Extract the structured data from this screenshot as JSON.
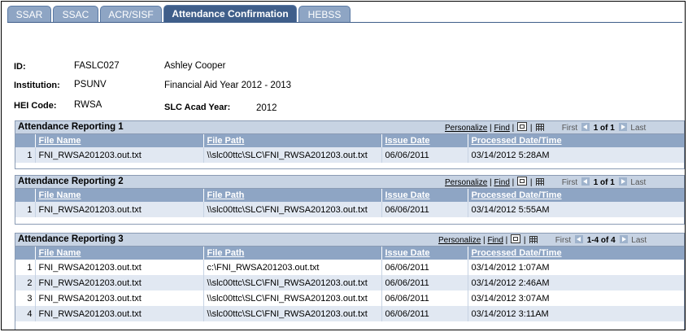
{
  "tabs": [
    {
      "label": "SSAR",
      "active": false
    },
    {
      "label": "SSAC",
      "active": false
    },
    {
      "label": "ACR/SISF",
      "active": false
    },
    {
      "label": "Attendance Confirmation",
      "active": true
    },
    {
      "label": "HEBSS",
      "active": false
    }
  ],
  "info": {
    "id_label": "ID:",
    "id_value": "FASLC027",
    "name": "Ashley Cooper",
    "institution_label": "Institution:",
    "institution_value": "PSUNV",
    "aid_year": "Financial Aid Year 2012 - 2013",
    "hei_label": "HEI Code:",
    "hei_value": "RWSA",
    "slc_label": "SLC Acad Year:",
    "slc_value": "2012"
  },
  "grid_nav": {
    "personalize": "Personalize",
    "separator": "|",
    "find": "Find",
    "first": "First",
    "last": "Last"
  },
  "columns": [
    "File Name",
    "File Path",
    "Issue Date",
    "Processed Date/Time"
  ],
  "grids": [
    {
      "title": "Attendance Reporting 1",
      "count": "1 of 1",
      "rows": [
        {
          "num": "1",
          "file_name": "FNI_RWSA201203.out.txt",
          "file_path": "\\\\slc00ttc\\SLC\\FNI_RWSA201203.out.txt",
          "issue_date": "06/06/2011",
          "processed": "03/14/2012  5:28AM"
        }
      ]
    },
    {
      "title": "Attendance Reporting 2",
      "count": "1 of 1",
      "rows": [
        {
          "num": "1",
          "file_name": "FNI_RWSA201203.out.txt",
          "file_path": "\\\\slc00ttc\\SLC\\FNI_RWSA201203.out.txt",
          "issue_date": "06/06/2011",
          "processed": "03/14/2012  5:55AM"
        }
      ]
    },
    {
      "title": "Attendance Reporting 3",
      "count": "1-4 of 4",
      "rows": [
        {
          "num": "1",
          "file_name": "FNI_RWSA201203.out.txt",
          "file_path": "c:\\FNI_RWSA201203.out.txt",
          "issue_date": "06/06/2011",
          "processed": "03/14/2012  1:07AM"
        },
        {
          "num": "2",
          "file_name": "FNI_RWSA201203.out.txt",
          "file_path": "\\\\slc00ttc\\SLC\\FNI_RWSA201203.out.txt",
          "issue_date": "06/06/2011",
          "processed": "03/14/2012  2:46AM"
        },
        {
          "num": "3",
          "file_name": "FNI_RWSA201203.out.txt",
          "file_path": "\\\\slc00ttc\\SLC\\FNI_RWSA201203.out.txt",
          "issue_date": "06/06/2011",
          "processed": "03/14/2012  3:07AM"
        },
        {
          "num": "4",
          "file_name": "FNI_RWSA201203.out.txt",
          "file_path": "\\\\slc00ttc\\SLC\\FNI_RWSA201203.out.txt",
          "issue_date": "06/06/2011",
          "processed": "03/14/2012  3:11AM"
        }
      ]
    }
  ]
}
